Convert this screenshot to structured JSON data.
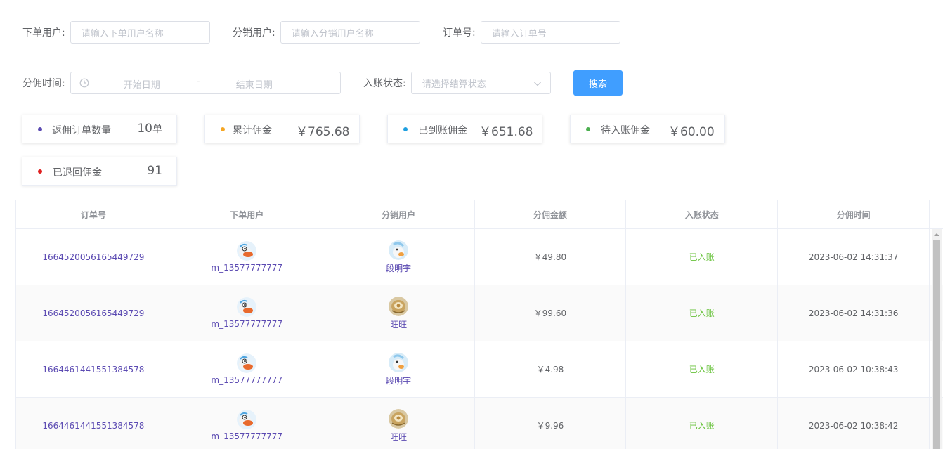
{
  "filters": {
    "order_user": {
      "label": "下单用户:",
      "placeholder": "请输入下单用户名称"
    },
    "dist_user": {
      "label": "分销用户:",
      "placeholder": "请输入分销用户名称"
    },
    "order_no": {
      "label": "订单号:",
      "placeholder": "请输入订单号"
    },
    "commission_time": {
      "label": "分佣时间:",
      "start_placeholder": "开始日期",
      "separator": "-",
      "end_placeholder": "结束日期"
    },
    "status": {
      "label": "入账状态:",
      "placeholder": "请选择结算状态"
    },
    "search_label": "搜索"
  },
  "stats": [
    {
      "title": "返佣订单数量",
      "value": "10",
      "unit": "单",
      "dot_color": "#5b4ab2"
    },
    {
      "title": "累计佣金",
      "value": "￥765.68",
      "unit": "",
      "dot_color": "#f5a623"
    },
    {
      "title": "已到账佣金",
      "value": "￥651.68",
      "unit": "",
      "dot_color": "#1e9fe0"
    },
    {
      "title": "待入账佣金",
      "value": "￥60.00",
      "unit": "",
      "dot_color": "#4caf50"
    },
    {
      "title": "已退回佣金",
      "value": "91",
      "unit": "",
      "dot_color": "#e02020"
    }
  ],
  "table": {
    "headers": [
      "订单号",
      "下单用户",
      "分销用户",
      "分佣金额",
      "入账状态",
      "分佣时间"
    ],
    "rows": [
      {
        "order_no": "1664520056165449729",
        "order_user": "m_13577777777",
        "dist_user": "段明宇",
        "dist_avatar": "duck-avatar-icon",
        "amount": "￥49.80",
        "status": "已入账",
        "time": "2023-06-02 14:31:37"
      },
      {
        "order_no": "1664520056165449729",
        "order_user": "m_13577777777",
        "dist_user": "旺旺",
        "dist_avatar": "bread-avatar-icon",
        "amount": "￥99.60",
        "status": "已入账",
        "time": "2023-06-02 14:31:36"
      },
      {
        "order_no": "1664461441551384578",
        "order_user": "m_13577777777",
        "dist_user": "段明宇",
        "dist_avatar": "duck-avatar-icon",
        "amount": "￥4.98",
        "status": "已入账",
        "time": "2023-06-02 10:38:43"
      },
      {
        "order_no": "1664461441551384578",
        "order_user": "m_13577777777",
        "dist_user": "旺旺",
        "dist_avatar": "bread-avatar-icon",
        "amount": "￥9.96",
        "status": "已入账",
        "time": "2023-06-02 10:38:42"
      }
    ]
  },
  "colors": {
    "primary": "#409eff",
    "link": "#5b4ab2",
    "success": "#67c23a",
    "border": "#dcdfe6"
  }
}
